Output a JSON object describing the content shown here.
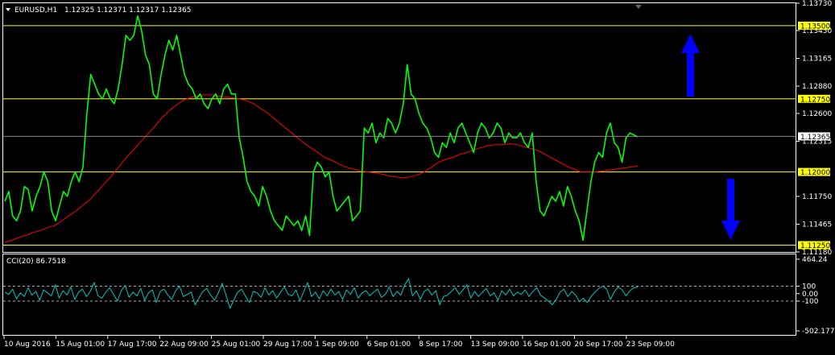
{
  "header": {
    "symbol": "EURUSD,H1",
    "ohlc": "1.12325 1.12371 1.12317 1.12365"
  },
  "indicator": {
    "label": "CCI(20) 86.7518"
  },
  "colors": {
    "background": "#000000",
    "price": "#00ff00",
    "ma": "#ff0000",
    "level_line": "#ffff00",
    "level_label_bg": "#ffff00",
    "cci": "#00c8c8",
    "arrow": "#0000ff"
  },
  "chart_data": [
    {
      "type": "line",
      "title": "EURUSD,H1",
      "ylim": [
        1.1118,
        1.1373
      ],
      "y_ticks": [
        "1.13730",
        "1.13450",
        "1.13165",
        "1.12880",
        "1.12600",
        "1.12315",
        "1.11750",
        "1.11465",
        "1.11180"
      ],
      "x_ticks": [
        "10 Aug 2016",
        "15 Aug 01:00",
        "17 Aug 17:00",
        "22 Aug 09:00",
        "25 Aug 01:00",
        "29 Aug 17:00",
        "1 Sep 09:00",
        "6 Sep 01:00",
        "8 Sep 17:00",
        "13 Sep 09:00",
        "16 Sep 01:00",
        "20 Sep 17:00",
        "23 Sep 09:00"
      ],
      "levels": [
        {
          "value": 1.135,
          "label": "1.13500"
        },
        {
          "value": 1.1275,
          "label": "1.12750"
        },
        {
          "value": 1.12,
          "label": "1.12000"
        },
        {
          "value": 1.1125,
          "label": "1.11250"
        }
      ],
      "current_price": {
        "value": 1.12365,
        "label": "1.12365"
      },
      "series": [
        {
          "values": [
            1.117,
            1.118,
            1.1155,
            1.115,
            1.116,
            1.1185,
            1.1182,
            1.116,
            1.1175,
            1.1185,
            1.12,
            1.119,
            1.116,
            1.115,
            1.1165,
            1.118,
            1.1175,
            1.119,
            1.12,
            1.119,
            1.1205,
            1.126,
            1.13,
            1.129,
            1.128,
            1.1275,
            1.1285,
            1.1275,
            1.127,
            1.1285,
            1.131,
            1.134,
            1.1335,
            1.134,
            1.136,
            1.1345,
            1.132,
            1.131,
            1.128,
            1.1275,
            1.13,
            1.132,
            1.1335,
            1.1325,
            1.134,
            1.132,
            1.13,
            1.129,
            1.1285,
            1.1275,
            1.128,
            1.127,
            1.1265,
            1.1275,
            1.128,
            1.127,
            1.1285,
            1.129,
            1.128,
            1.128,
            1.1235,
            1.1215,
            1.119,
            1.118,
            1.1175,
            1.1165,
            1.1185,
            1.1175,
            1.116,
            1.115,
            1.1145,
            1.114,
            1.1155,
            1.115,
            1.1145,
            1.115,
            1.114,
            1.1155,
            1.1135,
            1.12,
            1.121,
            1.1205,
            1.1195,
            1.12,
            1.1175,
            1.116,
            1.1165,
            1.117,
            1.1175,
            1.115,
            1.1155,
            1.116,
            1.1245,
            1.124,
            1.125,
            1.123,
            1.124,
            1.1235,
            1.1255,
            1.125,
            1.124,
            1.125,
            1.127,
            1.131,
            1.128,
            1.1275,
            1.126,
            1.125,
            1.1245,
            1.1235,
            1.122,
            1.1215,
            1.123,
            1.1225,
            1.124,
            1.123,
            1.1245,
            1.125,
            1.124,
            1.123,
            1.122,
            1.124,
            1.125,
            1.1245,
            1.1235,
            1.124,
            1.125,
            1.1245,
            1.123,
            1.124,
            1.1235,
            1.1235,
            1.124,
            1.123,
            1.1225,
            1.124,
            1.119,
            1.116,
            1.1155,
            1.1165,
            1.1175,
            1.117,
            1.118,
            1.1165,
            1.1185,
            1.1175,
            1.116,
            1.115,
            1.113,
            1.116,
            1.119,
            1.121,
            1.122,
            1.1215,
            1.124,
            1.125,
            1.123,
            1.1225,
            1.121,
            1.1235,
            1.124,
            1.1238,
            1.1236
          ]
        },
        {
          "values": [
            1.1128,
            1.113,
            1.1133,
            1.1135,
            1.1138,
            1.114,
            1.1143,
            1.1145,
            1.115,
            1.1155,
            1.116,
            1.1166,
            1.1172,
            1.118,
            1.1188,
            1.1196,
            1.1205,
            1.1214,
            1.1222,
            1.123,
            1.1238,
            1.1246,
            1.1255,
            1.1262,
            1.1268,
            1.1273,
            1.1276,
            1.1278,
            1.1279,
            1.1279,
            1.1278,
            1.1277,
            1.1276,
            1.1275,
            1.1273,
            1.127,
            1.1265,
            1.126,
            1.1254,
            1.1248,
            1.1242,
            1.1236,
            1.123,
            1.1225,
            1.122,
            1.1215,
            1.1212,
            1.1208,
            1.1205,
            1.1203,
            1.1201,
            1.12,
            1.1199,
            1.1198,
            1.1196,
            1.1195,
            1.1194,
            1.1195,
            1.1197,
            1.12,
            1.1205,
            1.121,
            1.1213,
            1.1215,
            1.1218,
            1.122,
            1.1223,
            1.1225,
            1.1227,
            1.1228,
            1.1228,
            1.1229,
            1.1228,
            1.1226,
            1.1224,
            1.1222,
            1.1218,
            1.1214,
            1.121,
            1.1206,
            1.1203,
            1.12,
            1.12,
            1.12,
            1.1201,
            1.1202,
            1.1203,
            1.1204,
            1.1205,
            1.1206
          ]
        }
      ]
    },
    {
      "type": "line",
      "title": "CCI(20) 86.7518",
      "ylim": [
        -502.1773,
        464.24
      ],
      "y_ticks": [
        "464.24",
        "100",
        "0.00",
        "-100",
        "-502.1773"
      ],
      "levels": [
        100,
        -100
      ],
      "series": [
        {
          "values": [
            20,
            -10,
            60,
            -70,
            10,
            -40,
            80,
            -20,
            30,
            -90,
            50,
            10,
            -30,
            120,
            -60,
            40,
            -20,
            90,
            -80,
            20,
            60,
            -40,
            30,
            150,
            -30,
            -60,
            20,
            80,
            -10,
            -100,
            40,
            110,
            -50,
            20,
            -30,
            70,
            -90,
            10,
            50,
            -120,
            30,
            60,
            -20,
            -80,
            40,
            100,
            -40,
            -10,
            20,
            -150,
            -60,
            30,
            70,
            -20,
            -90,
            10,
            140,
            -30,
            -200,
            -80,
            20,
            60,
            -40,
            -120,
            30,
            10,
            -50,
            80,
            -20,
            40,
            -60,
            20,
            90,
            -10,
            -30,
            50,
            -100,
            30,
            150,
            -40,
            20,
            -70,
            40,
            -30,
            60,
            -20,
            30,
            -80,
            50,
            -10,
            80,
            -60,
            10,
            40,
            -30,
            20,
            60,
            -50,
            -10,
            90,
            -40,
            30,
            -20,
            120,
            200,
            -30,
            40,
            -80,
            30,
            60,
            -20,
            40,
            -150,
            -40,
            -20,
            30,
            80,
            -10,
            50,
            120,
            -60,
            30,
            -40,
            20,
            70,
            -30,
            10,
            -90,
            40,
            -20,
            60,
            -30,
            20,
            -10,
            50,
            -40,
            30,
            80,
            -20,
            -60,
            -100,
            -150,
            -80,
            20,
            60,
            -40,
            30,
            -20,
            -110,
            -60,
            -120,
            -40,
            20,
            70,
            100,
            60,
            -80,
            30,
            90,
            50,
            -30,
            40,
            80,
            87
          ]
        }
      ]
    }
  ]
}
